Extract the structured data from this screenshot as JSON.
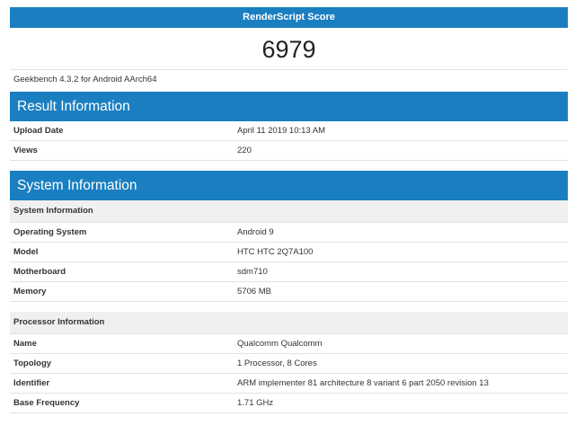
{
  "score": {
    "title": "RenderScript Score",
    "value": "6979"
  },
  "subtitle": "Geekbench 4.3.2 for Android AArch64",
  "result": {
    "title": "Result Information",
    "rows": [
      {
        "key": "Upload Date",
        "value": "April 11 2019 10:13 AM"
      },
      {
        "key": "Views",
        "value": "220"
      }
    ]
  },
  "system": {
    "title": "System Information",
    "group1": "System Information",
    "rows1": [
      {
        "key": "Operating System",
        "value": "Android 9"
      },
      {
        "key": "Model",
        "value": "HTC HTC 2Q7A100"
      },
      {
        "key": "Motherboard",
        "value": "sdm710"
      },
      {
        "key": "Memory",
        "value": "5706 MB"
      }
    ],
    "group2": "Processor Information",
    "rows2": [
      {
        "key": "Name",
        "value": "Qualcomm Qualcomm"
      },
      {
        "key": "Topology",
        "value": "1 Processor, 8 Cores"
      },
      {
        "key": "Identifier",
        "value": "ARM implementer 81 architecture 8 variant 6 part 2050 revision 13"
      },
      {
        "key": "Base Frequency",
        "value": "1.71 GHz"
      }
    ]
  }
}
